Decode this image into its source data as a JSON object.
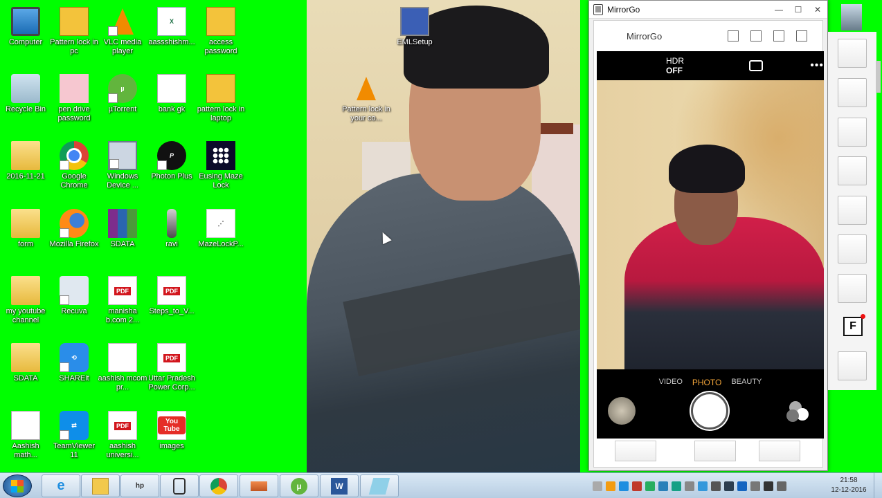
{
  "desktop": {
    "icons": [
      {
        "label": "Computer",
        "icon": "computer-icon"
      },
      {
        "label": "Pattern lock in pc",
        "icon": "image-icon"
      },
      {
        "label": "VLC media player",
        "icon": "vlc-icon"
      },
      {
        "label": "aassshishm...",
        "icon": "excel-icon"
      },
      {
        "label": "access password",
        "icon": "image-icon"
      },
      {
        "label": "Recycle Bin",
        "icon": "recycle-bin-icon"
      },
      {
        "label": "pen drive password",
        "icon": "image-icon"
      },
      {
        "label": "µTorrent",
        "icon": "utorrent-icon"
      },
      {
        "label": "bank gk",
        "icon": "document-icon"
      },
      {
        "label": "pattern lock in laptop",
        "icon": "image-icon"
      },
      {
        "label": "2016-11-21",
        "icon": "folder-icon"
      },
      {
        "label": "Google Chrome",
        "icon": "chrome-icon"
      },
      {
        "label": "Windows Device ...",
        "icon": "windows-device-icon"
      },
      {
        "label": "Photon Plus",
        "icon": "photon-icon"
      },
      {
        "label": "Eusing Maze Lock",
        "icon": "maze-lock-icon"
      },
      {
        "label": "form",
        "icon": "folder-icon"
      },
      {
        "label": "Mozilla Firefox",
        "icon": "firefox-icon"
      },
      {
        "label": "SDATA",
        "icon": "winrar-icon"
      },
      {
        "label": "ravi",
        "icon": "photo-icon"
      },
      {
        "label": "MazeLockP...",
        "icon": "mazelock-pattern-icon"
      },
      {
        "label": "my youtube channel",
        "icon": "folder-icon"
      },
      {
        "label": "Recuva",
        "icon": "recuva-icon"
      },
      {
        "label": "manisha b.com 2...",
        "icon": "pdf-icon"
      },
      {
        "label": "Steps_to_V...",
        "icon": "pdf-icon"
      },
      {
        "label": "SDATA",
        "icon": "folder-icon"
      },
      {
        "label": "SHAREit",
        "icon": "shareit-icon"
      },
      {
        "label": "aashish mcom pr...",
        "icon": "envelope-icon"
      },
      {
        "label": "Uttar Pradesh Power Corp...",
        "icon": "pdf-icon"
      },
      {
        "label": "Aashish math...",
        "icon": "document-icon"
      },
      {
        "label": "TeamViewer 11",
        "icon": "teamviewer-icon"
      },
      {
        "label": "aashish universi...",
        "icon": "pdf-icon"
      },
      {
        "label": "images",
        "icon": "youtube-icon"
      },
      {
        "label": "EMLSetup",
        "icon": "setup-icon"
      },
      {
        "label": "Pattern lock in your co...",
        "icon": "vlc-icon"
      }
    ],
    "pdf_badge": "PDF",
    "youtube_badge": "You Tube"
  },
  "mirrorgo": {
    "window_title": "MirrorGo",
    "header_title": "MirrorGo",
    "camera": {
      "hdr_label": "HDR",
      "hdr_state": "OFF",
      "more": "•••",
      "modes": [
        "VIDEO",
        "PHOTO",
        "BEAUTY"
      ],
      "active_mode": "PHOTO"
    }
  },
  "side_toolbar": {
    "f_label": "F"
  },
  "taskbar": {
    "clock_time": "21:58",
    "clock_date": "12-12-2016",
    "pinned": [
      "internet-explorer-icon",
      "file-explorer-icon",
      "hp-icon",
      "mirrorgo-icon",
      "chrome-icon",
      "media-icon",
      "utorrent-icon",
      "word-icon",
      "notepad-icon"
    ]
  },
  "colors": {
    "desktop_bg": "#00ff00",
    "accent_photo": "#f4a63a"
  }
}
